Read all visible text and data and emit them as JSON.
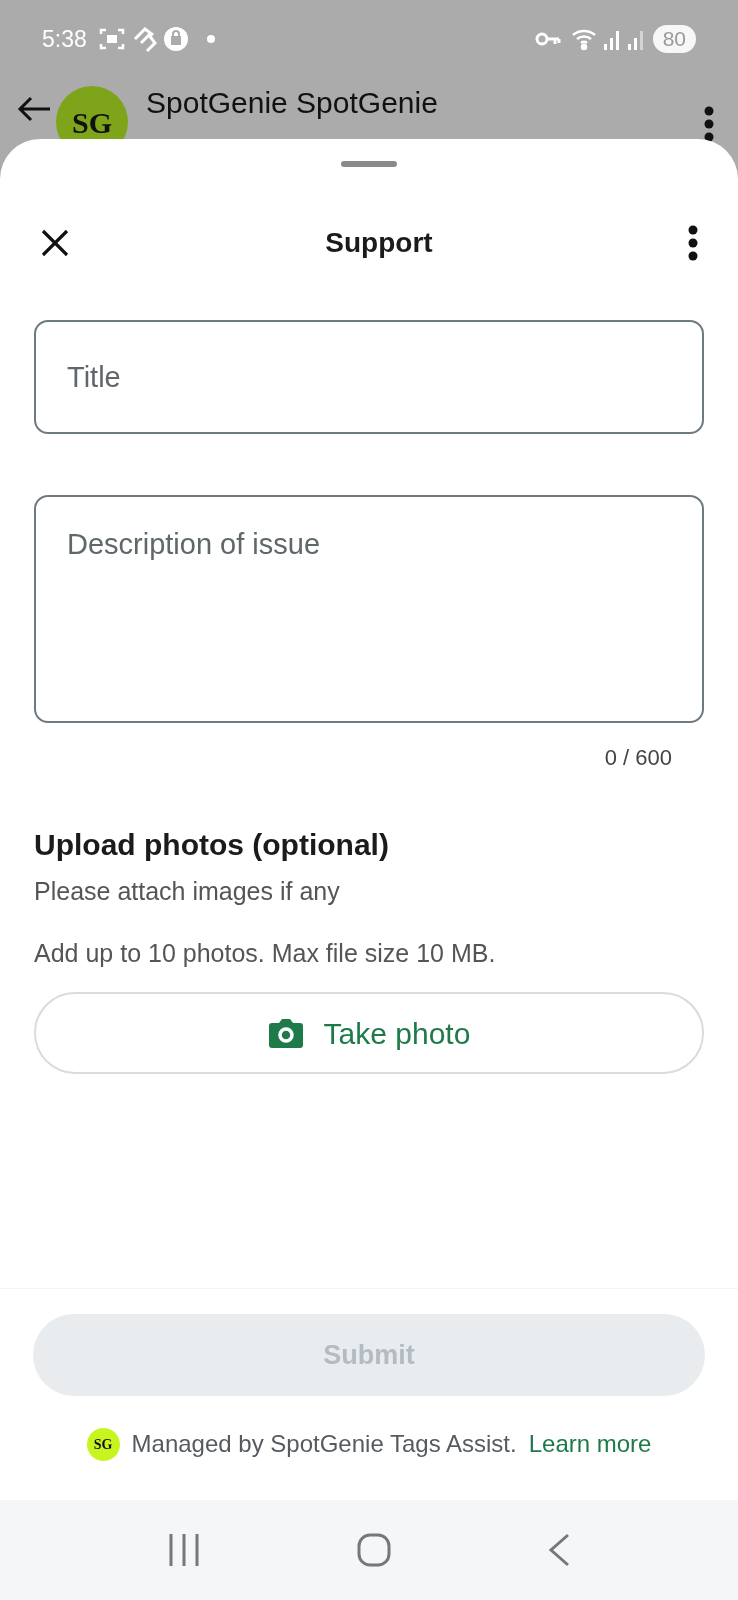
{
  "status_bar": {
    "time": "5:38",
    "battery": "80"
  },
  "background_chat": {
    "avatar": "SG",
    "title": "SpotGenie SpotGenie"
  },
  "sheet": {
    "title": "Support",
    "fields": [
      {
        "placeholder": "Title",
        "kind": "single"
      },
      {
        "placeholder": "Description of issue",
        "kind": "multi"
      }
    ],
    "counter": "0 / 600",
    "upload": {
      "heading": "Upload photos (optional)",
      "subtitle": "Please attach images if any",
      "info": "Add up to 10 photos. Max file size 10 MB.",
      "button": "Take photo"
    },
    "submit": {
      "label": "Submit",
      "disabled": true
    },
    "footer": {
      "avatar": "SG",
      "text": "Managed by SpotGenie Tags Assist.",
      "link": "Learn more"
    }
  }
}
